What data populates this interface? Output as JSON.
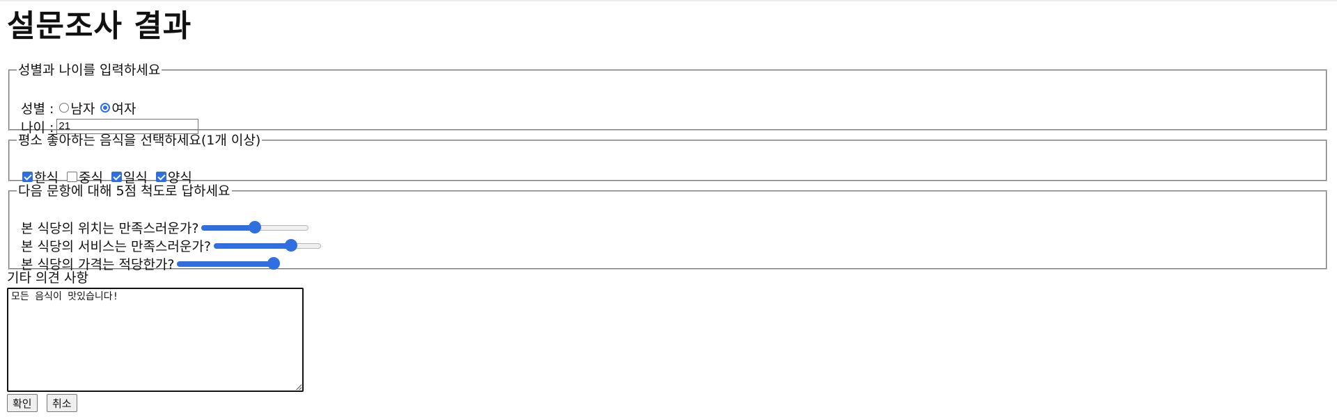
{
  "page": {
    "title": "설문조사 결과"
  },
  "section1": {
    "legend": "성별과 나이를 입력하세요",
    "gender_label": "성별 :",
    "gender_options": [
      "남자",
      "여자"
    ],
    "gender_selected": "여자",
    "age_label": "나이 :",
    "age_value": "21"
  },
  "section2": {
    "legend": "평소 좋아하는 음식을 선택하세요(1개 이상)",
    "options": [
      {
        "label": "한식",
        "checked": true
      },
      {
        "label": "중식",
        "checked": false
      },
      {
        "label": "일식",
        "checked": true
      },
      {
        "label": "양식",
        "checked": true
      }
    ]
  },
  "section3": {
    "legend": "다음 문항에 대해 5점 척도로 답하세요",
    "questions": [
      {
        "text": "본 식당의 위치는 만족스러운가?",
        "value": 3,
        "max": 5
      },
      {
        "text": "본 식당의 서비스는 만족스러운가?",
        "value": 4,
        "max": 5
      },
      {
        "text": "본 식당의 가격는 적당한가?",
        "value": 5,
        "max": 5
      }
    ]
  },
  "opinion": {
    "label": "기타 의견 사항",
    "value": "모든 음식이 맛있습니다!"
  },
  "buttons": {
    "confirm": "확인",
    "cancel": "취소"
  },
  "colors": {
    "accent": "#2f6fe0"
  }
}
